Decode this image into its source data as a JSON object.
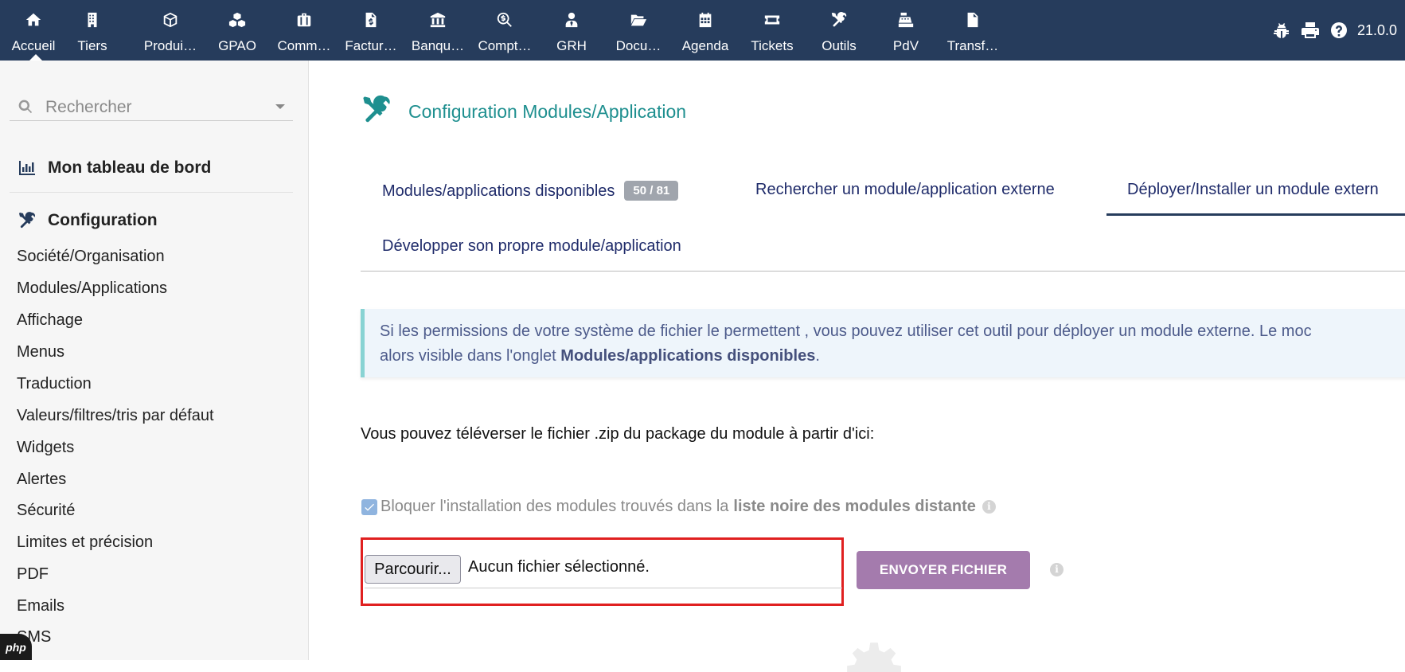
{
  "topbar": {
    "items": [
      {
        "label": "Accueil",
        "icon": "home-icon"
      },
      {
        "label": "Tiers",
        "icon": "building-icon"
      },
      {
        "label": "Produi…",
        "icon": "cube-icon"
      },
      {
        "label": "GPAO",
        "icon": "cubes-icon"
      },
      {
        "label": "Comm…",
        "icon": "suitcase-icon"
      },
      {
        "label": "Factur…",
        "icon": "invoice-icon"
      },
      {
        "label": "Banqu…",
        "icon": "bank-icon"
      },
      {
        "label": "Compt…",
        "icon": "search-dollar-icon"
      },
      {
        "label": "GRH",
        "icon": "user-tie-icon"
      },
      {
        "label": "Docu…",
        "icon": "folder-open-icon"
      },
      {
        "label": "Agenda",
        "icon": "calendar-icon"
      },
      {
        "label": "Tickets",
        "icon": "ticket-icon"
      },
      {
        "label": "Outils",
        "icon": "tools-icon"
      },
      {
        "label": "PdV",
        "icon": "cash-register-icon"
      },
      {
        "label": "Transf…",
        "icon": "file-icon"
      }
    ],
    "version": "21.0.0"
  },
  "sidebar": {
    "search_placeholder": "Rechercher",
    "dashboard": "Mon tableau de bord",
    "section_title": "Configuration",
    "links": [
      "Société/Organisation",
      "Modules/Applications",
      "Affichage",
      "Menus",
      "Traduction",
      "Valeurs/filtres/tris par défaut",
      "Widgets",
      "Alertes",
      "Sécurité",
      "Limites et précision",
      "PDF",
      "Emails",
      "SMS"
    ],
    "php_badge": "php"
  },
  "main": {
    "title": "Configuration Modules/Application",
    "tabs": {
      "available": "Modules/applications disponibles",
      "available_badge": "50 / 81",
      "search_external": "Rechercher un module/application externe",
      "deploy": "Déployer/Installer un module extern",
      "develop": "Développer son propre module/application"
    },
    "info": {
      "line1": "Si les permissions de votre système de fichier le permettent , vous pouvez utiliser cet outil pour déployer un module externe. Le moc",
      "line2_prefix": "alors visible dans l'onglet ",
      "line2_bold": "Modules/applications disponibles",
      "line2_suffix": "."
    },
    "upload_text": "Vous pouvez téléverser le fichier .zip du package du module à partir d'ici:",
    "checkbox": {
      "checked": true,
      "label_prefix": "Bloquer l'installation des modules trouvés dans la",
      "label_bold": "liste noire des modules distante"
    },
    "file_button": "Parcourir...",
    "file_status": "Aucun fichier sélectionné.",
    "send_button": "ENVOYER FICHIER"
  },
  "colors": {
    "topbar": "#263c5c",
    "accent_title": "#1e8f8f",
    "tab_text": "#1f2b6a",
    "send_button": "#a47bad",
    "highlight_frame": "#e02020"
  }
}
